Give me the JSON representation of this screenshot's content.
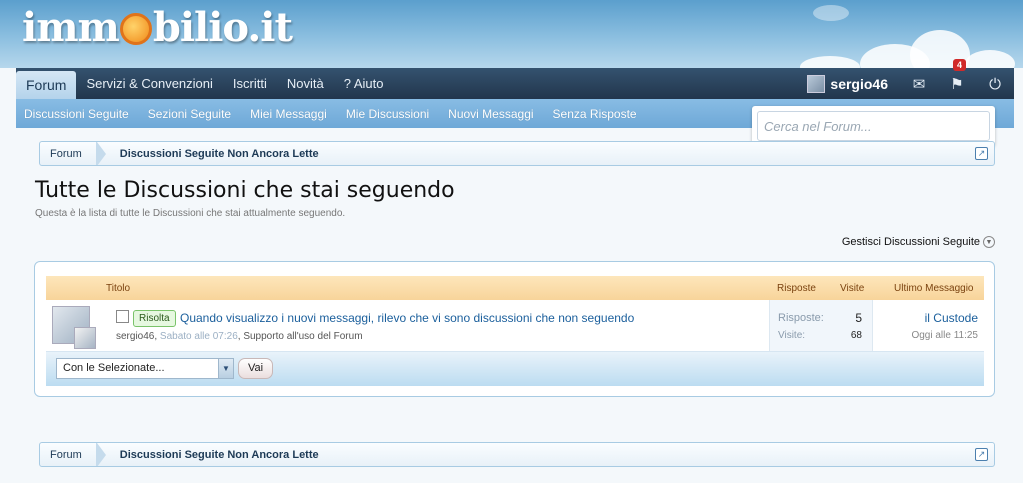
{
  "logo": {
    "left": "imm",
    "right": "bilio.it"
  },
  "navbar": {
    "tabs": [
      {
        "label": "Forum",
        "active": true
      },
      {
        "label": "Servizi & Convenzioni",
        "active": false
      },
      {
        "label": "Iscritti",
        "active": false
      },
      {
        "label": "Novità",
        "active": false
      },
      {
        "label": "? Aiuto",
        "active": false
      }
    ],
    "username": "sergio46",
    "alerts_count": "4"
  },
  "subnav": {
    "links": [
      "Discussioni Seguite",
      "Sezioni Seguite",
      "Miei Messaggi",
      "Mie Discussioni",
      "Nuovi Messaggi",
      "Senza Risposte"
    ]
  },
  "search": {
    "placeholder": "Cerca nel Forum..."
  },
  "breadcrumb": {
    "home": "Forum",
    "current": "Discussioni Seguite Non Ancora Lette"
  },
  "page": {
    "title": "Tutte le Discussioni che stai seguendo",
    "description": "Questa è la lista di tutte le Discussioni che stai attualmente seguendo.",
    "manage_link": "Gestisci Discussioni Seguite"
  },
  "list": {
    "headers": {
      "title": "Titolo",
      "replies": "Risposte",
      "views": "Visite",
      "last_post": "Ultimo Messaggio"
    },
    "threads": [
      {
        "prefix": "Risolta",
        "title": "Quando visualizzo i nuovi messaggi, rilevo che vi sono discussioni che non seguendo",
        "author": "sergio46",
        "date": "Sabato alle 07:26",
        "forum": "Supporto all'uso del Forum",
        "replies_label": "Risposte:",
        "replies": "5",
        "views_label": "Visite:",
        "views": "68",
        "last_post_user": "il Custode",
        "last_post_date": "Oggi alle 11:25"
      }
    ],
    "mass_action": {
      "selected": "Con le Selezionate...",
      "button": "Vai"
    }
  },
  "colors": {
    "navbar": "#22364c",
    "subnav": "#6ea8d7",
    "header_row": "#f8d49a",
    "link": "#1b5f9c"
  }
}
